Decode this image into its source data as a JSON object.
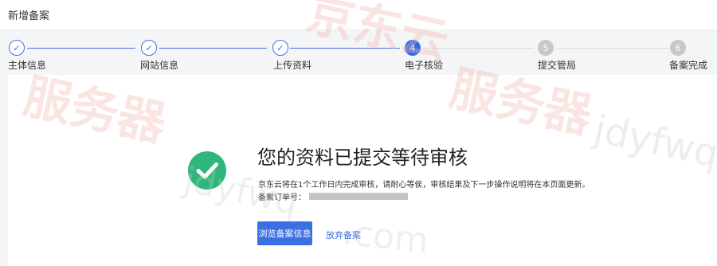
{
  "header": {
    "title": "新增备案"
  },
  "steps": [
    {
      "number": "✓",
      "label": "主体信息",
      "state": "done"
    },
    {
      "number": "✓",
      "label": "网站信息",
      "state": "done"
    },
    {
      "number": "✓",
      "label": "上传资料",
      "state": "done"
    },
    {
      "number": "4",
      "label": "电子核验",
      "state": "active"
    },
    {
      "number": "5",
      "label": "提交管局",
      "state": "todo"
    },
    {
      "number": "6",
      "label": "备案完成",
      "state": "todo"
    }
  ],
  "main": {
    "title": "您的资料已提交等待审核",
    "description": "京东云将在1个工作日内完成审核，请耐心等侯，审核结果及下一步操作说明将在本页面更新。",
    "order_label": "备案订单号：",
    "primary_button": "浏览备案信息",
    "secondary_link": "放弃备案"
  },
  "watermark": {
    "text1": "京东云",
    "text2": "服务器",
    "text3": "jdyfwq",
    "text4": ".com"
  },
  "colors": {
    "primary": "#3b6fe4",
    "success": "#2fb67a",
    "watermark": "#f2b6ad"
  },
  "icons": {
    "success": "check-circle-icon"
  }
}
